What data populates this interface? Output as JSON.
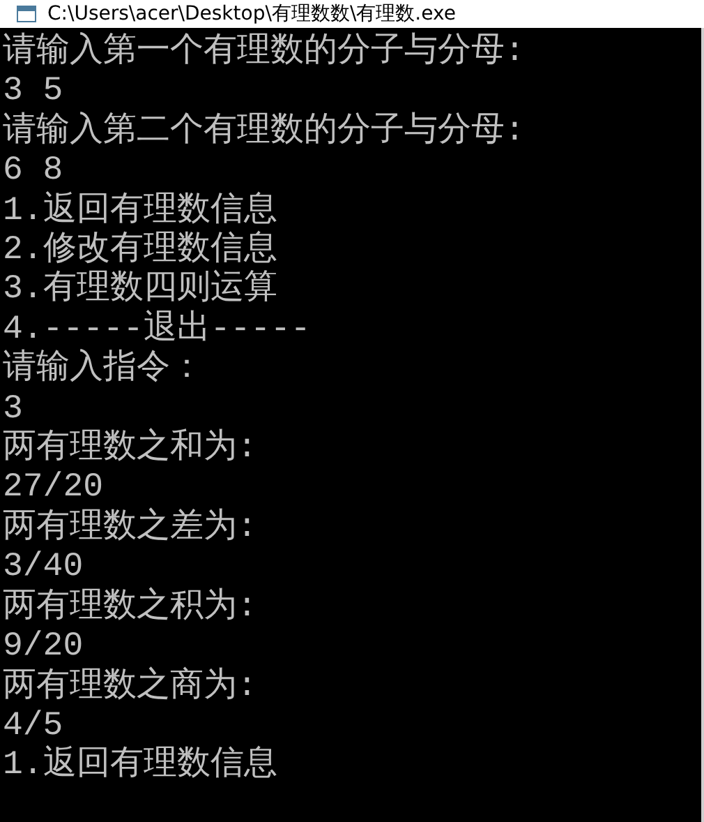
{
  "window": {
    "title": "C:\\Users\\acer\\Desktop\\有理数数\\有理数.exe"
  },
  "console": {
    "lines": [
      "请输入第一个有理数的分子与分母:",
      "3 5",
      "请输入第二个有理数的分子与分母:",
      "6 8",
      "1.返回有理数信息",
      "2.修改有理数信息",
      "3.有理数四则运算",
      "4.-----退出-----",
      "请输入指令：",
      "3",
      "两有理数之和为:",
      "27/20",
      "两有理数之差为:",
      "3/40",
      "两有理数之积为:",
      "9/20",
      "两有理数之商为:",
      "4/5",
      "1.返回有理数信息"
    ]
  }
}
